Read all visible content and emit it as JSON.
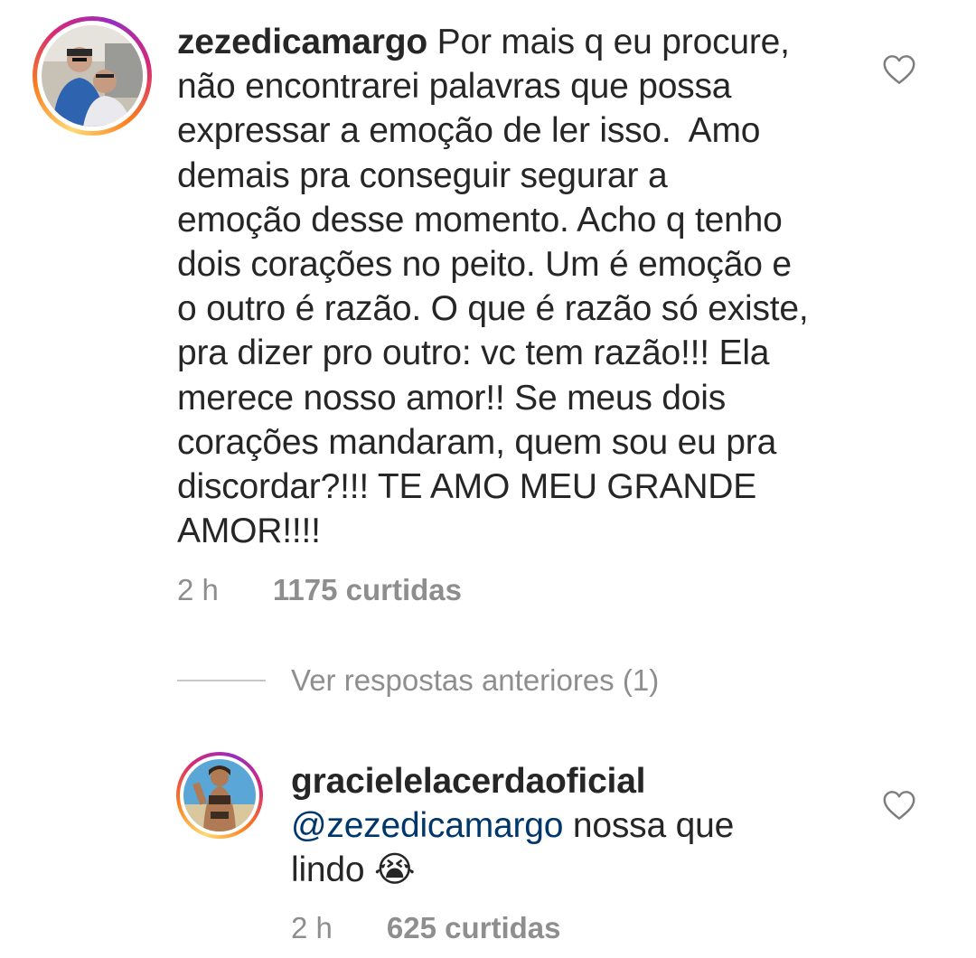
{
  "comments": [
    {
      "username": "zezedicamargo",
      "text": "Por mais q eu procure,\nnão encontrarei palavras que possa\nexpressar a emoção de ler isso.  Amo\ndemais pra conseguir segurar a\nemoção desse momento. Acho q tenho\ndois corações no peito. Um é emoção e\no outro é razão. O que é razão só existe,\npra dizer pro outro: vc tem razão!!! Ela\nmerece nosso amor!! Se meus dois\ncorações mandaram, quem sou eu pra\ndiscordar?!!! TE AMO MEU GRANDE\nAMOR!!!!",
      "time": "2 h",
      "likes": "1175 curtidas",
      "heart_icon": "heart-outline-icon"
    },
    {
      "username": "gracielelacerdaoficial",
      "mention": "@zezedicamargo",
      "text_after_mention": " nossa que",
      "text_line2": "lindo ",
      "emoji": "😭",
      "time": "2 h",
      "likes": "625 curtidas",
      "heart_icon": "heart-outline-icon"
    }
  ],
  "view_previous_replies": "Ver respostas anteriores (1)"
}
